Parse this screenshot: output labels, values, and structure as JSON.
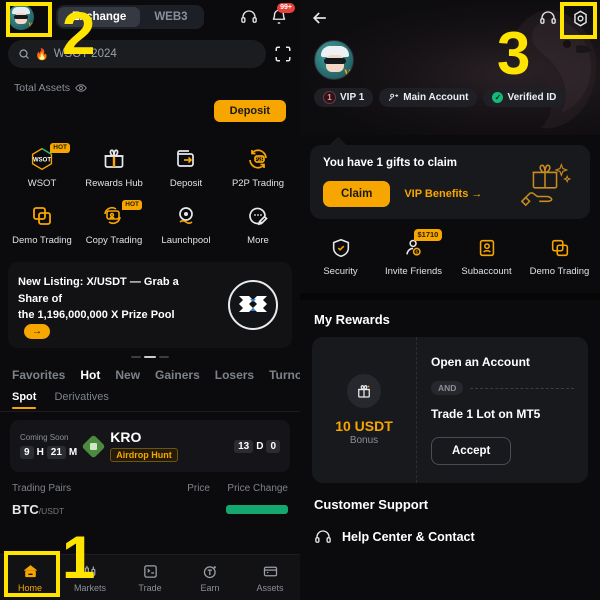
{
  "left": {
    "topbar": {
      "avatar_name": "user-avatar",
      "tabs": [
        {
          "label": "Exchange",
          "active": true
        },
        {
          "label": "WEB3",
          "active": false
        }
      ],
      "support_icon": "headset-icon",
      "notification_icon": "bell-icon",
      "notification_badge": "99+"
    },
    "search": {
      "value": "WSOT 2024",
      "flame": "🔥",
      "scan_icon": "scan-icon"
    },
    "assets": {
      "label": "Total Assets",
      "eye_icon": "eye-icon",
      "deposit_label": "Deposit"
    },
    "quick_actions": [
      {
        "label": "WSOT",
        "icon": "wsot-icon",
        "badge": "HOT"
      },
      {
        "label": "Rewards Hub",
        "icon": "gift-icon",
        "badge": ""
      },
      {
        "label": "Deposit",
        "icon": "wallet-deposit-icon",
        "badge": ""
      },
      {
        "label": "P2P Trading",
        "icon": "p2p-icon",
        "badge": ""
      },
      {
        "label": "Demo Trading",
        "icon": "demo-squares-icon",
        "badge": ""
      },
      {
        "label": "Copy Trading",
        "icon": "copy-trading-icon",
        "badge": "HOT"
      },
      {
        "label": "Launchpool",
        "icon": "launchpool-icon",
        "badge": ""
      },
      {
        "label": "More",
        "icon": "more-icon",
        "badge": ""
      }
    ],
    "banner": {
      "line1": "New Listing: X/USDT — Grab a Share of",
      "line2": "the 1,196,000,000 X Prize Pool",
      "arrow": "→",
      "logo_name": "x-token-logo"
    },
    "market_tabs": [
      "Favorites",
      "Hot",
      "New",
      "Gainers",
      "Losers",
      "Turnov"
    ],
    "market_tab_active": "Hot",
    "sub_tabs": [
      "Spot",
      "Derivatives"
    ],
    "sub_tab_active": "Spot",
    "coming_soon": {
      "label": "Coming Soon",
      "left_count": [
        "9",
        "H",
        "21",
        "M"
      ],
      "name": "KRO",
      "tag": "Airdrop Hunt",
      "right_count": [
        "13",
        "D",
        "0"
      ]
    },
    "list_header": {
      "pairs": "Trading Pairs",
      "price": "Price",
      "change": "Price Change"
    },
    "first_row": {
      "symbol": "BTC",
      "quote": "/USDT"
    },
    "bottom_nav": [
      {
        "label": "Home",
        "icon": "home-icon",
        "active": true
      },
      {
        "label": "Markets",
        "icon": "candles-icon",
        "active": false
      },
      {
        "label": "Trade",
        "icon": "trade-icon",
        "active": false
      },
      {
        "label": "Earn",
        "icon": "earn-icon",
        "active": false
      },
      {
        "label": "Assets",
        "icon": "assets-wallet-icon",
        "active": false
      }
    ]
  },
  "right": {
    "back_icon": "back-arrow-icon",
    "support_icon": "headset-icon",
    "settings_icon": "settings-gear-icon",
    "chips": [
      {
        "label": "VIP 1",
        "level": "1",
        "icon": "vip-circle-icon"
      },
      {
        "label": "Main Account",
        "icon": "person-switch-icon"
      },
      {
        "label": "Verified ID",
        "icon": "verified-check-icon"
      }
    ],
    "gift_card": {
      "title": "You have 1 gifts to claim",
      "claim_label": "Claim",
      "benefits_label": "VIP Benefits →",
      "image_name": "gift-in-hand-icon"
    },
    "quick_actions": [
      {
        "label": "Security",
        "icon": "shield-check-icon",
        "badge": ""
      },
      {
        "label": "Invite Friends",
        "icon": "invite-person-icon",
        "badge": "$1710"
      },
      {
        "label": "Subaccount",
        "icon": "subaccount-icon",
        "badge": ""
      },
      {
        "label": "Demo Trading",
        "icon": "demo-squares-icon",
        "badge": ""
      }
    ],
    "rewards": {
      "title": "My Rewards",
      "amount": "10 USDT",
      "bonus": "Bonus",
      "icon": "reward-gift-icon",
      "step1": "Open an Account",
      "and": "AND",
      "step2": "Trade 1 Lot on MT5",
      "accept_label": "Accept"
    },
    "support": {
      "title": "Customer Support",
      "help_label": "Help Center & Contact",
      "help_icon": "headset-icon"
    }
  },
  "annotations": [
    {
      "number": "1",
      "target": "home-nav-item"
    },
    {
      "number": "2",
      "target": "profile-avatar"
    },
    {
      "number": "3",
      "target": "settings-gear"
    }
  ],
  "colors": {
    "accent": "#F7A600",
    "marker": "#FFE400",
    "green": "#16B979",
    "red": "#E8413A",
    "bg": "#0B0B0D"
  }
}
